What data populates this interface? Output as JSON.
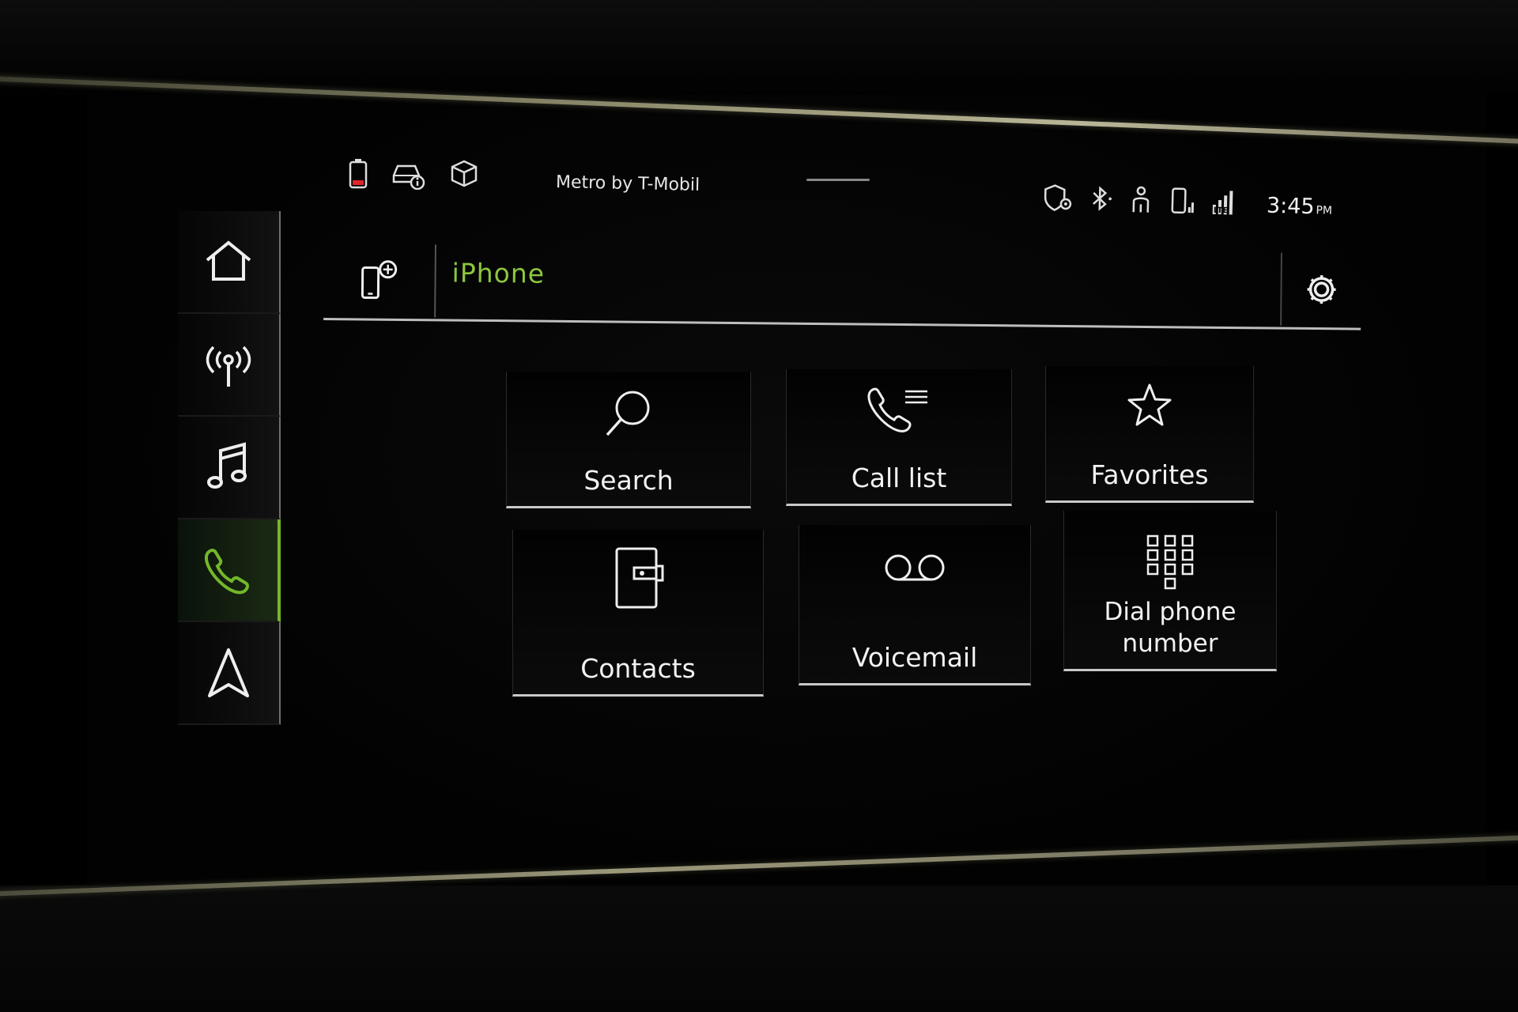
{
  "status_bar": {
    "carrier": "Metro by T-Mobil",
    "time": "3:45",
    "ampm": "PM",
    "left_icons": [
      "phone-battery-icon",
      "car-info-icon",
      "package-icon"
    ],
    "right_icons": [
      "location-shield-icon",
      "bluetooth-icon",
      "person-seat-icon",
      "phone-signal-icon",
      "lte-icon"
    ]
  },
  "nav": {
    "items": [
      {
        "name": "home",
        "icon": "home-icon"
      },
      {
        "name": "radio",
        "icon": "radio-antenna-icon"
      },
      {
        "name": "media",
        "icon": "music-note-icon"
      },
      {
        "name": "phone",
        "icon": "phone-handset-icon",
        "active": true
      },
      {
        "name": "navigation",
        "icon": "navigation-arrow-icon"
      }
    ],
    "active_color": "#74b72b"
  },
  "header": {
    "title": "iPhone",
    "title_color": "#8cc63f",
    "left_icon": "add-phone-icon",
    "right_icon": "gear-icon"
  },
  "tiles": {
    "search": {
      "label": "Search",
      "icon": "magnifier-icon"
    },
    "call_list": {
      "label": "Call list",
      "icon": "call-list-icon"
    },
    "favorites": {
      "label": "Favorites",
      "icon": "star-icon"
    },
    "contacts": {
      "label": "Contacts",
      "icon": "contact-book-icon"
    },
    "voicemail": {
      "label": "Voicemail",
      "icon": "voicemail-icon"
    },
    "dial": {
      "label_line1": "Dial phone",
      "label_line2": "number",
      "icon": "keypad-icon"
    }
  }
}
